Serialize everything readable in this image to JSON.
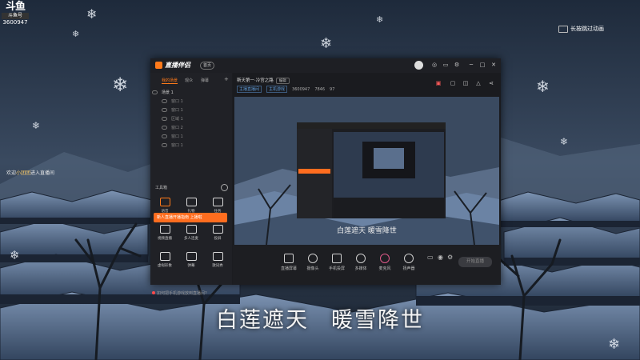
{
  "overlay": {
    "platform_logo": "斗鱼",
    "platform_tag": "斗鱼号",
    "room_id": "3600947",
    "skip_text": "长按跳过动画",
    "welcome_prefix": "欢迎",
    "welcome_name": "小团团",
    "welcome_suffix": "进入直播间",
    "subtitle_part1": "白莲遮天",
    "subtitle_part2": "暖雪降世",
    "preview_subtitle": "白莲遮天  暖雪降世"
  },
  "app": {
    "name": "直播伴侣",
    "badge": "首页"
  },
  "sidebar": {
    "tabs": [
      "我的场景",
      "观众",
      "弹幕"
    ],
    "scenes": [
      "场景 1",
      "窗口 1",
      "窗口 1",
      "区域 1",
      "窗口 2",
      "窗口 1",
      "窗口 1"
    ],
    "tools_header": "工具箱",
    "promo": "新人直播开播指南 上播啦",
    "tools": [
      "语音",
      "礼物",
      "任务",
      "视频直播",
      "多人连麦",
      "投屏",
      "虚拟形象",
      "弹幕",
      "歌词秀",
      "更多",
      "道具",
      "截图"
    ],
    "footer": "如何把手机游戏放到直播间?"
  },
  "main": {
    "room_title": "斯天第一·冷宫之路",
    "room_badge": "编辑",
    "meta_link": "主播直播间",
    "meta_category": "主机游戏",
    "meta_id": "3600947",
    "meta_fans": "7846",
    "meta_num": "97",
    "controls": [
      "直播屏幕",
      "摄像头",
      "手机投屏",
      "多媒体",
      "麦克风",
      "扬声器"
    ],
    "go_live": "开始直播"
  },
  "colors": {
    "accent": "#ff7a1a",
    "window_bg": "#1b1c20",
    "sky": "#2a3648"
  }
}
